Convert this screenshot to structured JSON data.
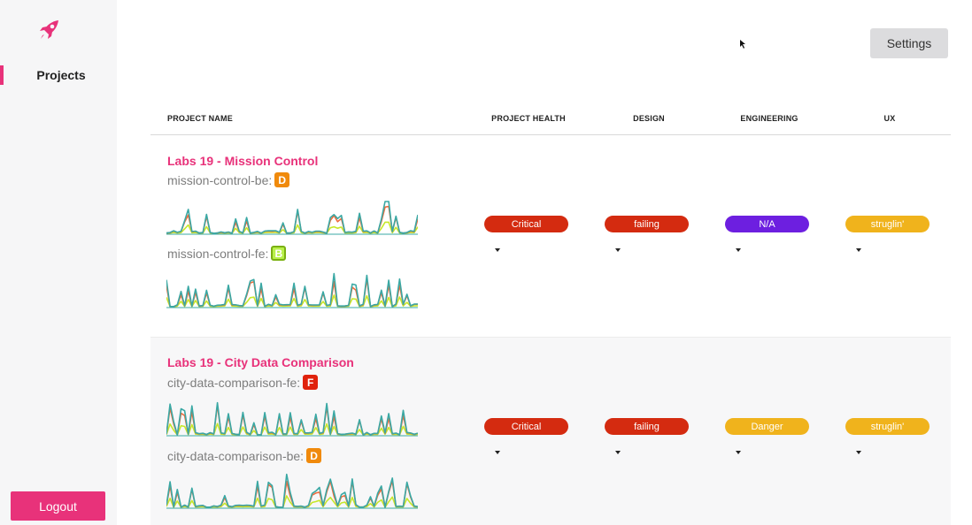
{
  "sidebar": {
    "logo_icon": "rocket-icon",
    "nav_items": [
      {
        "label": "Projects",
        "active": true
      }
    ],
    "logout_label": "Logout"
  },
  "toolbar": {
    "settings_label": "Settings"
  },
  "colors": {
    "brand": "#e8327a",
    "critical": "#d42b10",
    "failing": "#d42b10",
    "na": "#6d1fe0",
    "danger": "#f0b31c",
    "struggling": "#f0b31c",
    "grade_D": "#f08a0c",
    "grade_B": "#a8e62e",
    "grade_F": "#e0220c"
  },
  "table": {
    "columns": [
      "PROJECT NAME",
      "PROJECT HEALTH",
      "DESIGN",
      "ENGINEERING",
      "UX"
    ],
    "projects": [
      {
        "title": "Labs 19 - Mission Control",
        "repos": [
          {
            "name": "mission-control-be:",
            "grade": "D"
          },
          {
            "name": "mission-control-fe:",
            "grade": "B"
          }
        ],
        "statuses": [
          {
            "label": "Critical",
            "color": "critical"
          },
          {
            "label": "failing",
            "color": "failing"
          },
          {
            "label": "N/A",
            "color": "na"
          },
          {
            "label": "struglin'",
            "color": "struggling"
          }
        ]
      },
      {
        "title": "Labs 19 - City Data Comparison",
        "repos": [
          {
            "name": "city-data-comparison-fe:",
            "grade": "F"
          },
          {
            "name": "city-data-comparison-be:",
            "grade": "D"
          }
        ],
        "statuses": [
          {
            "label": "Critical",
            "color": "critical"
          },
          {
            "label": "failing",
            "color": "failing"
          },
          {
            "label": "Danger",
            "color": "danger"
          },
          {
            "label": "struglin'",
            "color": "struggling"
          }
        ]
      }
    ]
  }
}
